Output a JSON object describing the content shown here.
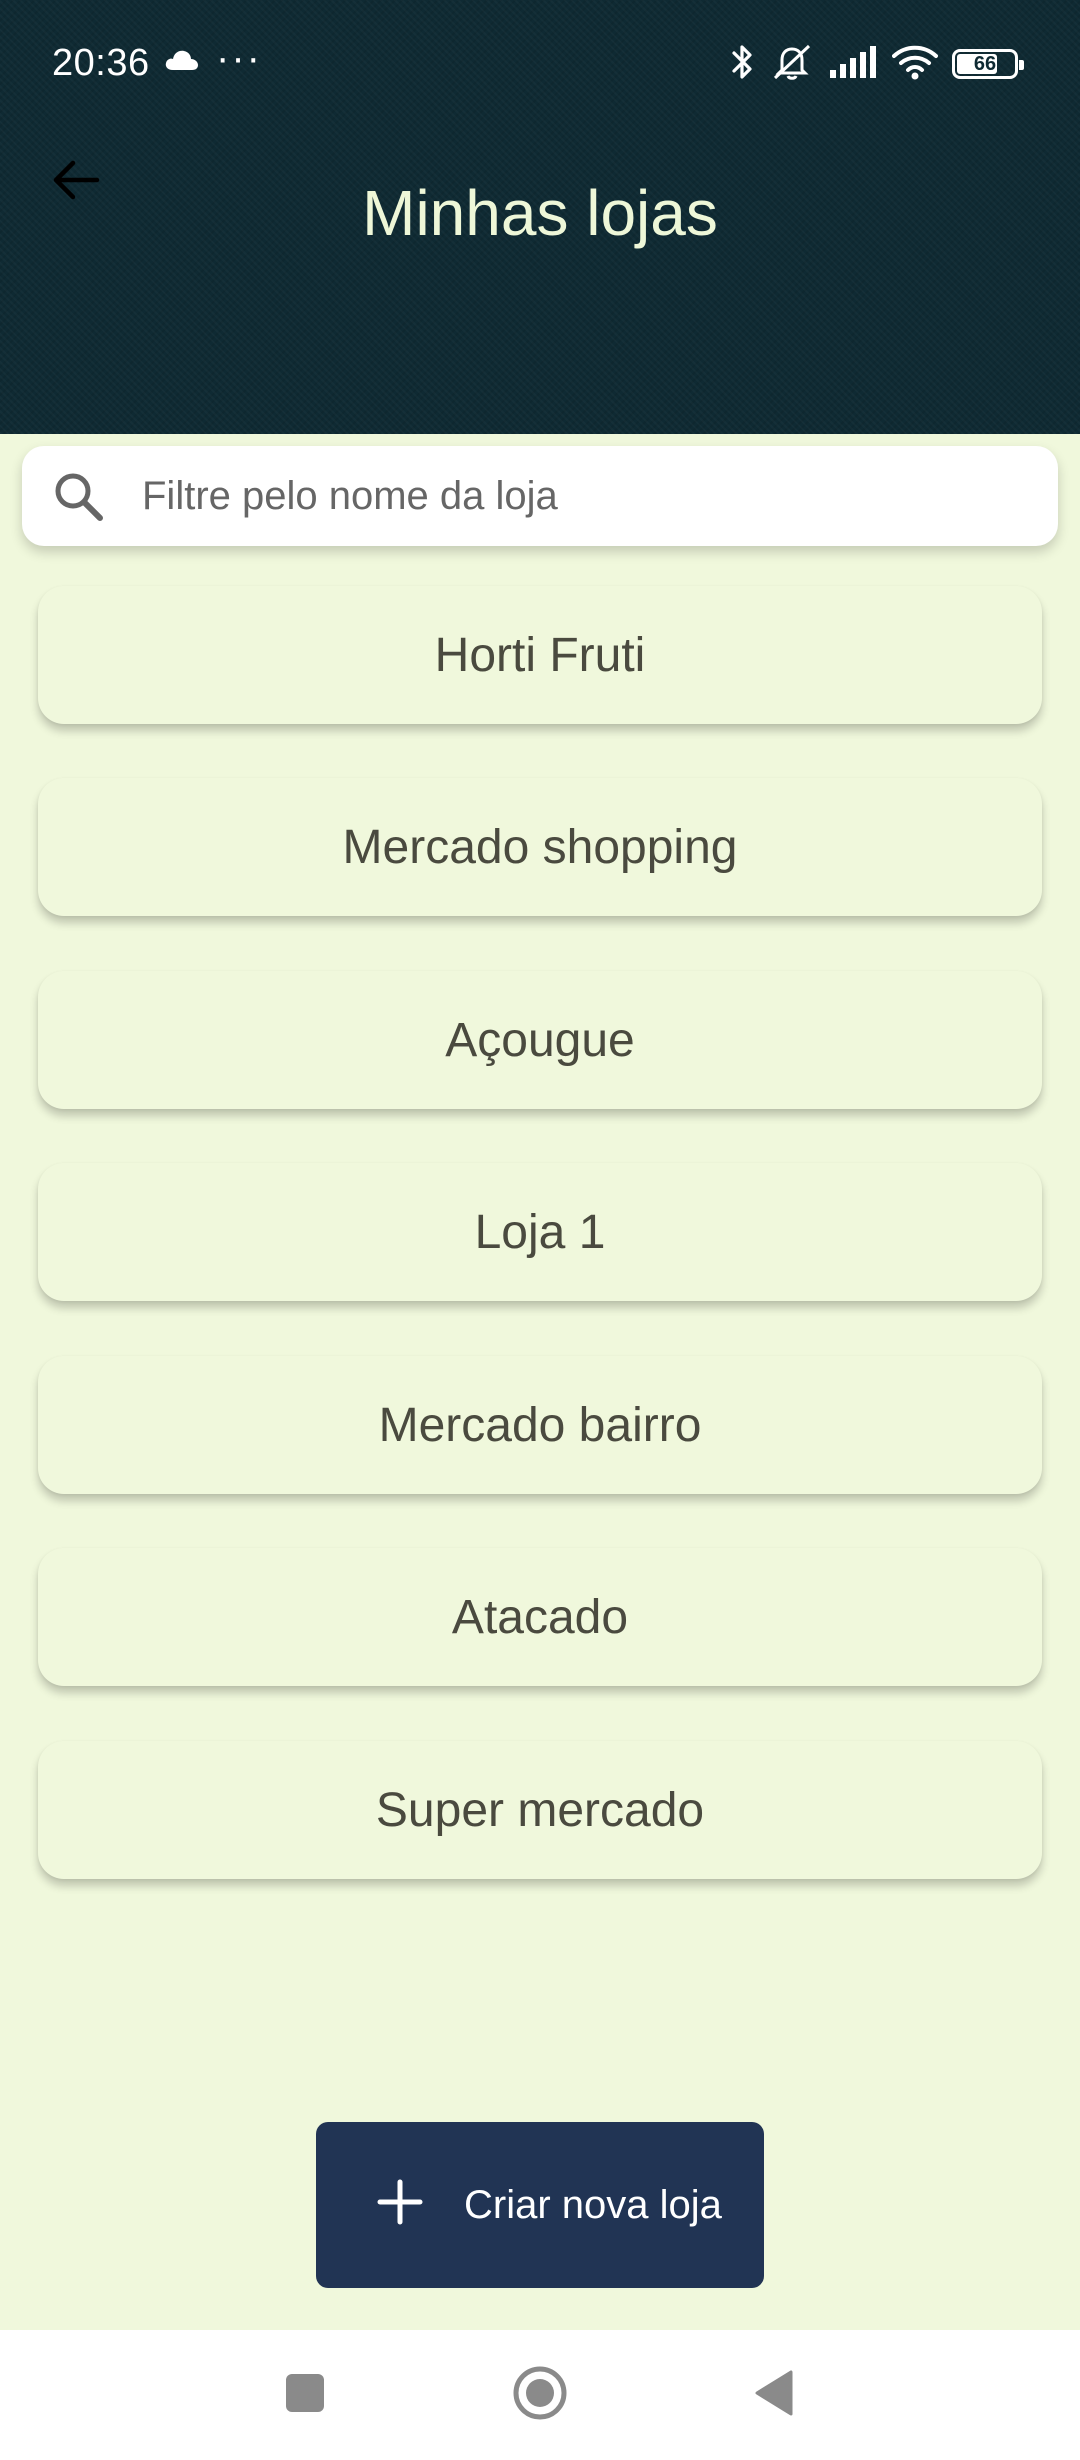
{
  "status_bar": {
    "time": "20:36",
    "dots": "···",
    "battery_level": "66"
  },
  "header": {
    "title": "Minhas lojas",
    "back_icon": "arrow-left-icon"
  },
  "search": {
    "placeholder": "Filtre pelo nome da loja",
    "value": ""
  },
  "stores": [
    {
      "name": "Horti Fruti"
    },
    {
      "name": "Mercado shopping"
    },
    {
      "name": "Açougue"
    },
    {
      "name": "Loja 1"
    },
    {
      "name": "Mercado bairro"
    },
    {
      "name": "Atacado"
    },
    {
      "name": "Super mercado"
    }
  ],
  "create_button": {
    "label": "Criar nova loja",
    "icon": "plus-icon"
  },
  "nav_bar": {
    "recents_icon": "square-icon",
    "home_icon": "circle-icon",
    "back_icon": "triangle-back-icon"
  },
  "colors": {
    "header_bg": "#0f2a33",
    "page_bg": "#f0f8dc",
    "title_text": "#eef7d8",
    "button_bg": "#213454",
    "card_text": "#4a4a3f"
  }
}
